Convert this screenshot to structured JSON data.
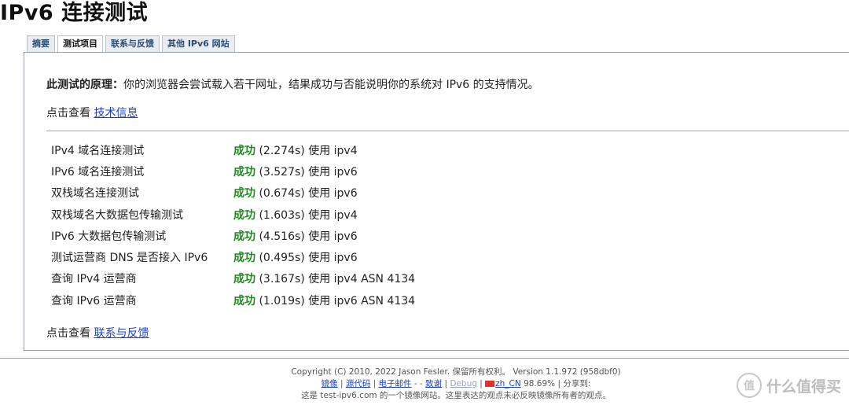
{
  "page": {
    "title": "IPv6 连接测试"
  },
  "tabs": [
    {
      "label": "摘要"
    },
    {
      "label": "测试项目",
      "active": true
    },
    {
      "label": "联系与反馈"
    },
    {
      "label": "其他 IPv6 网站"
    }
  ],
  "principle": {
    "label": "此测试的原理：",
    "text": "你的浏览器会尝试载入若干网址，结果成功与否能说明你的系统对 IPv6 的支持情况。"
  },
  "tech": {
    "prefix": "点击查看 ",
    "link": "技术信息"
  },
  "results": [
    {
      "name": "IPv4 域名连接测试",
      "status": "成功",
      "detail": "(2.274s) 使用 ipv4"
    },
    {
      "name": "IPv6 域名连接测试",
      "status": "成功",
      "detail": "(3.527s) 使用 ipv6"
    },
    {
      "name": "双栈域名连接测试",
      "status": "成功",
      "detail": "(0.674s) 使用 ipv6"
    },
    {
      "name": "双栈域名大数据包传输测试",
      "status": "成功",
      "detail": "(1.603s) 使用 ipv4"
    },
    {
      "name": "IPv6 大数据包传输测试",
      "status": "成功",
      "detail": "(4.516s) 使用 ipv6"
    },
    {
      "name": "测试运营商 DNS 是否接入 IPv6",
      "status": "成功",
      "detail": "(0.495s) 使用 ipv6"
    },
    {
      "name": "查询 IPv4 运营商",
      "status": "成功",
      "detail": "(3.167s) 使用 ipv4 ASN 4134"
    },
    {
      "name": "查询 IPv6 运营商",
      "status": "成功",
      "detail": "(1.019s) 使用 ipv6 ASN 4134"
    }
  ],
  "feedback": {
    "prefix": "点击查看 ",
    "link": "联系与反馈"
  },
  "footer": {
    "copyright": "Copyright (C) 2010, 2022 Jason Fesler. 保留所有权利。 Version 1.1.972 (958dbf0)",
    "links": {
      "mirror": "镜像",
      "source": "源代码",
      "email": "电子邮件",
      "email_suffix": " -",
      "dash": " - ",
      "thanks": "致谢",
      "debug": "Debug",
      "locale": "zh_CN",
      "percent": " 98.69%",
      "share": " | 分享到:"
    },
    "mirror_note": "这是 test-ipv6.com 的一个镜像网站。这里表达的观点未必反映镜像所有者的观点。"
  },
  "watermark": {
    "logo": "值",
    "text": "什么值得买"
  }
}
